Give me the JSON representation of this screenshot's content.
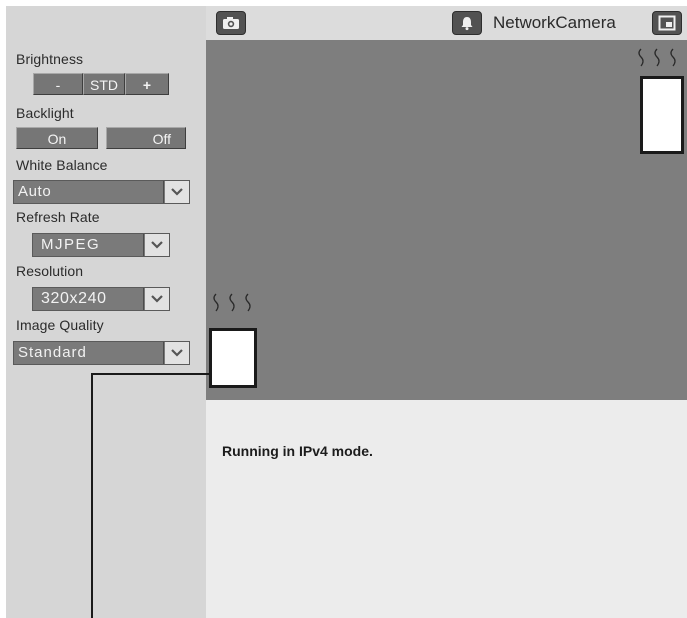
{
  "header": {
    "title": "NetworkCamera",
    "snapshot_icon": "camera-icon",
    "alarm_icon": "bell-icon",
    "fullscreen_icon": "window-icon"
  },
  "controls": {
    "brightness": {
      "label": "Brightness",
      "minus": "-",
      "std": "STD",
      "plus": "+"
    },
    "backlight": {
      "label": "Backlight",
      "on": "On",
      "off": "Off"
    },
    "white_balance": {
      "label": "White Balance",
      "value": "Auto"
    },
    "refresh_rate": {
      "label": "Refresh Rate",
      "value": "MJPEG"
    },
    "resolution": {
      "label": "Resolution",
      "value": "320x240"
    },
    "image_quality": {
      "label": "Image Quality",
      "value": "Standard"
    }
  },
  "status": {
    "text": "Running in IPv4 mode."
  },
  "colors": {
    "panel": "#d6d6d6",
    "video": "#7e7e7e",
    "button": "#767676"
  }
}
